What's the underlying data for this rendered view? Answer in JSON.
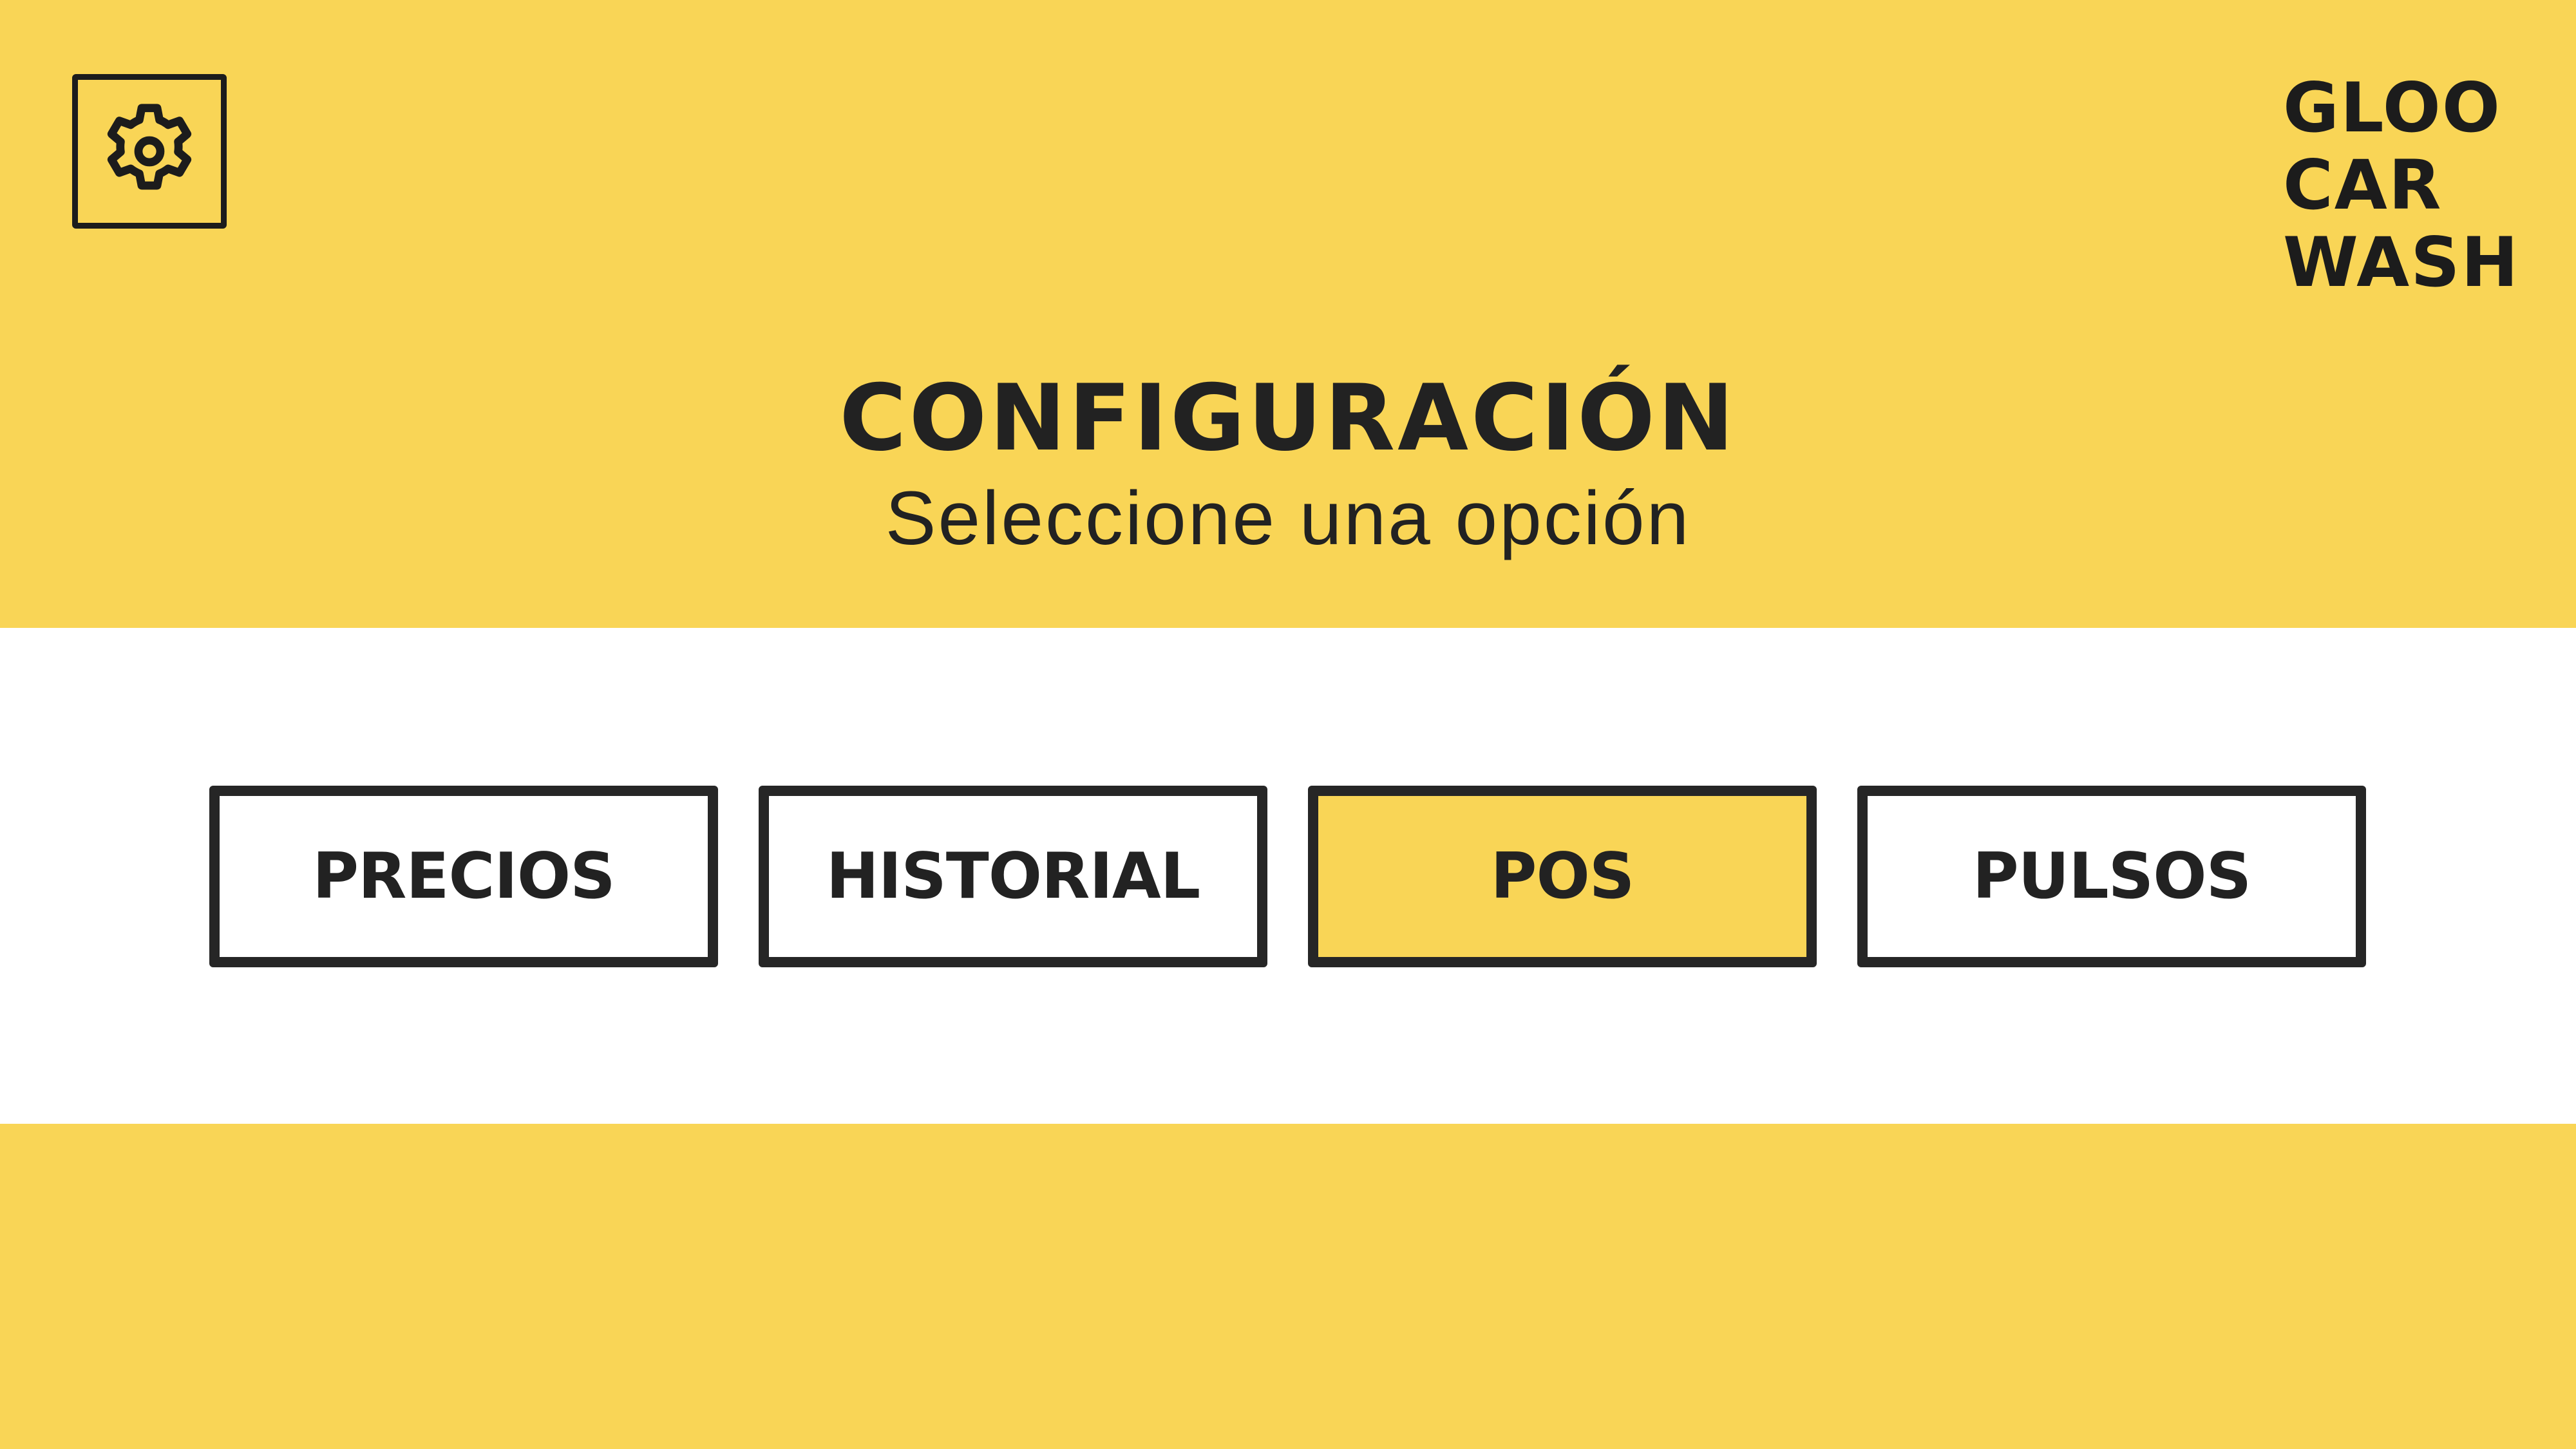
{
  "header": {
    "settings_icon": "gear-icon",
    "logo_lines": [
      "GLOO",
      "CAR",
      "WASH"
    ],
    "title": "CONFIGURACIÓN",
    "subtitle": "Seleccione una opción"
  },
  "options": [
    {
      "label": "PRECIOS",
      "selected": false
    },
    {
      "label": "HISTORIAL",
      "selected": false
    },
    {
      "label": "POS",
      "selected": true
    },
    {
      "label": "PULSOS",
      "selected": false
    }
  ],
  "colors": {
    "accent": "#F9D556",
    "background": "#FFFFFF",
    "text": "#222222",
    "border": "#262626"
  }
}
